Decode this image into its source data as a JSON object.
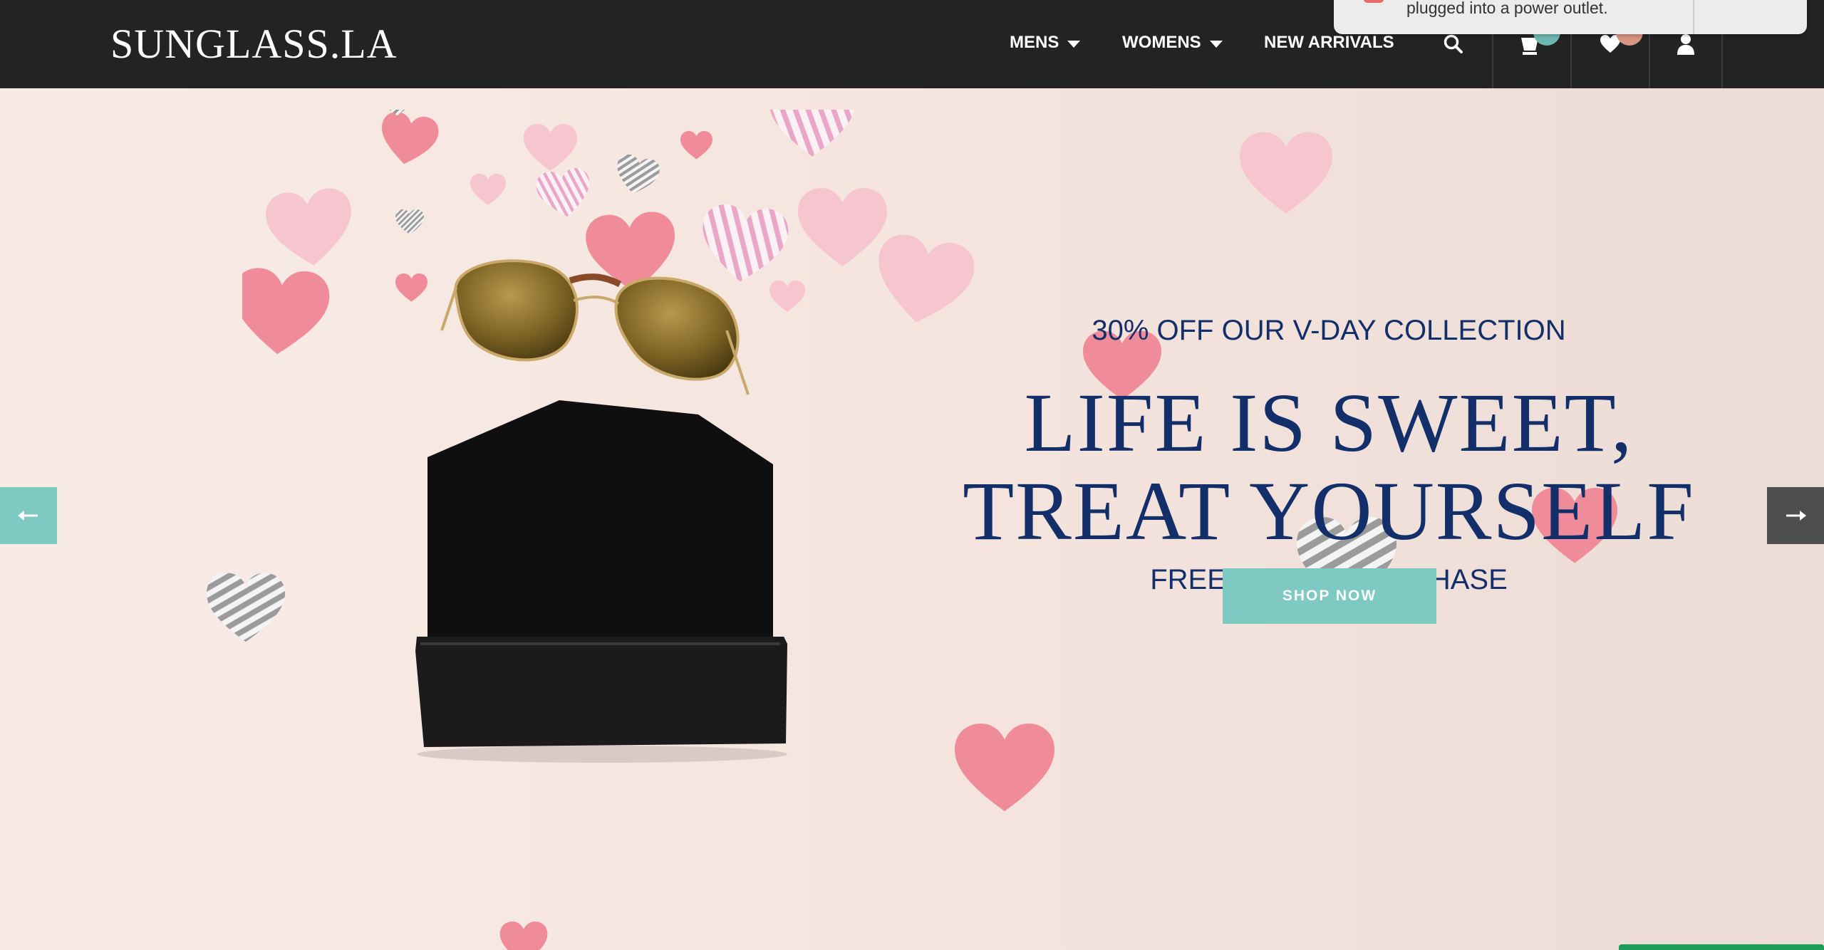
{
  "header": {
    "logo": "SUNGLASS.LA",
    "nav": [
      {
        "label": "MENS",
        "has_dropdown": true
      },
      {
        "label": "WOMENS",
        "has_dropdown": true
      },
      {
        "label": "NEW ARRIVALS",
        "has_dropdown": false
      }
    ],
    "icons": [
      "search-icon",
      "cart-icon",
      "wishlist-heart-icon",
      "account-icon"
    ]
  },
  "notification": {
    "text": "plugged into a power outlet."
  },
  "hero": {
    "kicker": "30% OFF OUR V-DAY COLLECTION",
    "headline_line1": "LIFE IS SWEET,",
    "headline_line2": "TREAT YOURSELF",
    "subline": "FREE GIFT W/ PURCHASE",
    "cta": "SHOP NOW",
    "prev_icon": "arrow-left-icon",
    "next_icon": "arrow-right-icon"
  },
  "colors": {
    "header_bg": "#222424",
    "headline": "#132f6a",
    "accent_teal": "#7ec9c1",
    "arrow_teal": "#7ec9c1",
    "arrow_dark": "#4d4f4f",
    "heart_pink": "#f08c9a",
    "heart_light": "#f6c6d0"
  }
}
